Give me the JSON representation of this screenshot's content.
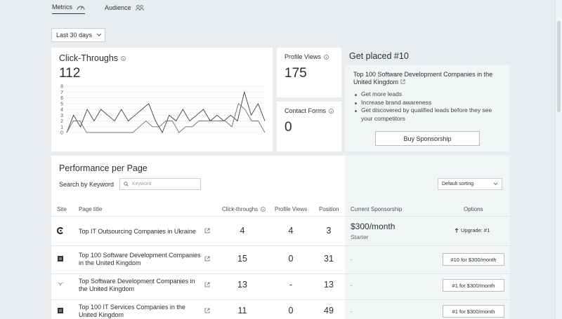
{
  "tabs": [
    {
      "label": "Metrics",
      "icon": "gauge-icon"
    },
    {
      "label": "Audience",
      "icon": "users-icon"
    }
  ],
  "date_range": {
    "selected": "Last 30 days"
  },
  "click_throughs": {
    "title": "Click-Throughs",
    "value": "112",
    "chart_data": {
      "type": "line",
      "y_ticks": [
        "8",
        "7",
        "6",
        "5",
        "4",
        "3",
        "2",
        "1",
        "0"
      ],
      "ylim": [
        0,
        8
      ],
      "series": [
        {
          "values": [
            0,
            3,
            1,
            4,
            2,
            4,
            3,
            2,
            4,
            2,
            3,
            4,
            5,
            2,
            0,
            3,
            2,
            4,
            2,
            3,
            4,
            2,
            3,
            2,
            3,
            2,
            7,
            3,
            5,
            2
          ]
        },
        {
          "values": [
            0,
            2,
            2,
            0,
            0,
            0,
            0,
            0,
            0,
            0,
            0,
            1,
            2,
            1,
            1,
            2,
            2,
            0,
            1,
            1,
            2,
            2,
            2,
            2,
            2,
            1,
            5,
            4,
            2,
            2,
            0
          ]
        }
      ]
    }
  },
  "profile_views": {
    "title": "Profile Views",
    "value": "175"
  },
  "contact_forms": {
    "title": "Contact Forms",
    "value": "0"
  },
  "get_placed": {
    "title": "Get placed #10",
    "heading": "Top 100 Software Development Companies in the United Kingdom",
    "bullets": [
      "Get more leads",
      "Increase brand awareness",
      "Get discovered by qualified leads before they see your competitors"
    ],
    "button": "Buy Sponsorship"
  },
  "performance": {
    "title": "Performance per Page",
    "search_label": "Search by Keyword",
    "search_placeholder": "Keyword",
    "sort_selected": "Default sorting",
    "columns": {
      "site": "Site",
      "page_title": "Page title",
      "click_throughs": "Click-throughs",
      "profile_views": "Profile Views",
      "position": "Position",
      "sponsorship": "Current Sponsorship",
      "options": "Options"
    },
    "rows": [
      {
        "site_icon": "c-logo-icon",
        "title": "Top IT Outsourcing Companies in Ukraine",
        "clicks": "4",
        "views": "4",
        "position": "3",
        "sponsorship": "$300/month",
        "sponsorship_sub": "Starter",
        "option": "Upgrade: #1"
      },
      {
        "site_icon": "square-logo-icon",
        "title": "Top 100 Software Development Companies in the United Kingdom",
        "clicks": "15",
        "views": "0",
        "position": "31",
        "sponsorship": "-",
        "option": "#10 for $300/month"
      },
      {
        "site_icon": "wing-logo-icon",
        "title": "Top Software Development Companies in the United Kingdom",
        "clicks": "13",
        "views": "-",
        "position": "13",
        "sponsorship": "-",
        "option": "#1 for $300/month"
      },
      {
        "site_icon": "square-logo-icon",
        "title": "Top 100 IT Services Companies in the United Kingdom",
        "clicks": "11",
        "views": "0",
        "position": "49",
        "sponsorship": "-",
        "option": "#1 for $300/month"
      }
    ]
  }
}
